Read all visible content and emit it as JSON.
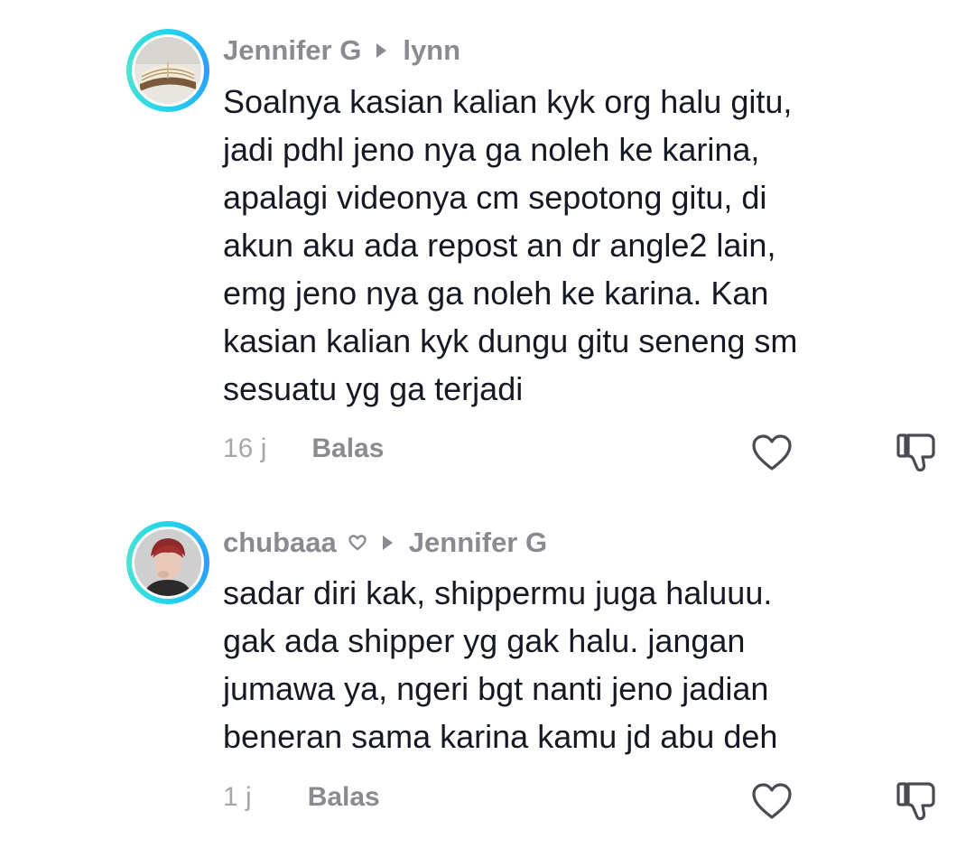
{
  "comments": [
    {
      "username": "Jennifer G",
      "reply_to": "lynn",
      "avatar": "book-avatar",
      "text_lines": [
        "Soalnya kasian kalian kyk org halu gitu,",
        "jadi pdhl jeno nya ga noleh ke karina,",
        "apalagi videonya cm sepotong gitu, di",
        "akun aku ada repost an dr angle2 lain,",
        "emg jeno nya ga noleh ke karina. Kan",
        "kasian kalian kyk dungu gitu seneng sm",
        "sesuatu yg ga terjadi"
      ],
      "time": "16 j",
      "reply_label": "Balas",
      "like_icon": "heart-outline-icon",
      "dislike_icon": "thumbs-down-icon"
    },
    {
      "username": "chubaaa",
      "username_badge_icon": "small-heart-icon",
      "reply_to": "Jennifer G",
      "avatar": "person-avatar",
      "text_lines": [
        "sadar diri kak, shippermu juga haluuu.",
        "gak ada shipper yg gak halu. jangan",
        "jumawa ya, ngeri bgt nanti jeno jadian",
        "beneran sama karina kamu jd abu deh"
      ],
      "time": "1 j",
      "reply_label": "Balas",
      "like_icon": "heart-outline-icon",
      "dislike_icon": "thumbs-down-icon"
    }
  ],
  "colors": {
    "text": "#161823",
    "secondary": "#8a8b91",
    "muted": "#a6a7ab",
    "ring": "#20d5ec"
  }
}
